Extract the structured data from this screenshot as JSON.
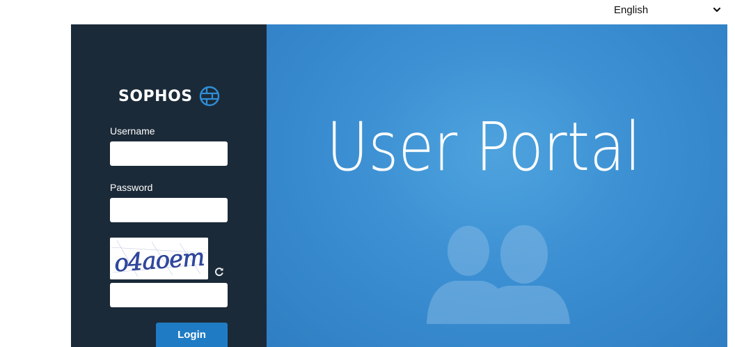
{
  "language": {
    "selected": "English"
  },
  "brand": {
    "name": "SOPHOS"
  },
  "login": {
    "username_label": "Username",
    "username_value": "",
    "password_label": "Password",
    "password_value": "",
    "captcha_text": "o4aoem",
    "captcha_value": "",
    "submit_label": "Login"
  },
  "banner": {
    "title": "User Portal"
  },
  "icons": {
    "brand": "sophos-firewall-icon",
    "refresh": "refresh-icon",
    "illustration": "users-icon",
    "dropdown": "chevron-down-icon"
  },
  "colors": {
    "panel": "#1b2a38",
    "banner": "#3b8fd2",
    "button": "#1f7cc4"
  }
}
